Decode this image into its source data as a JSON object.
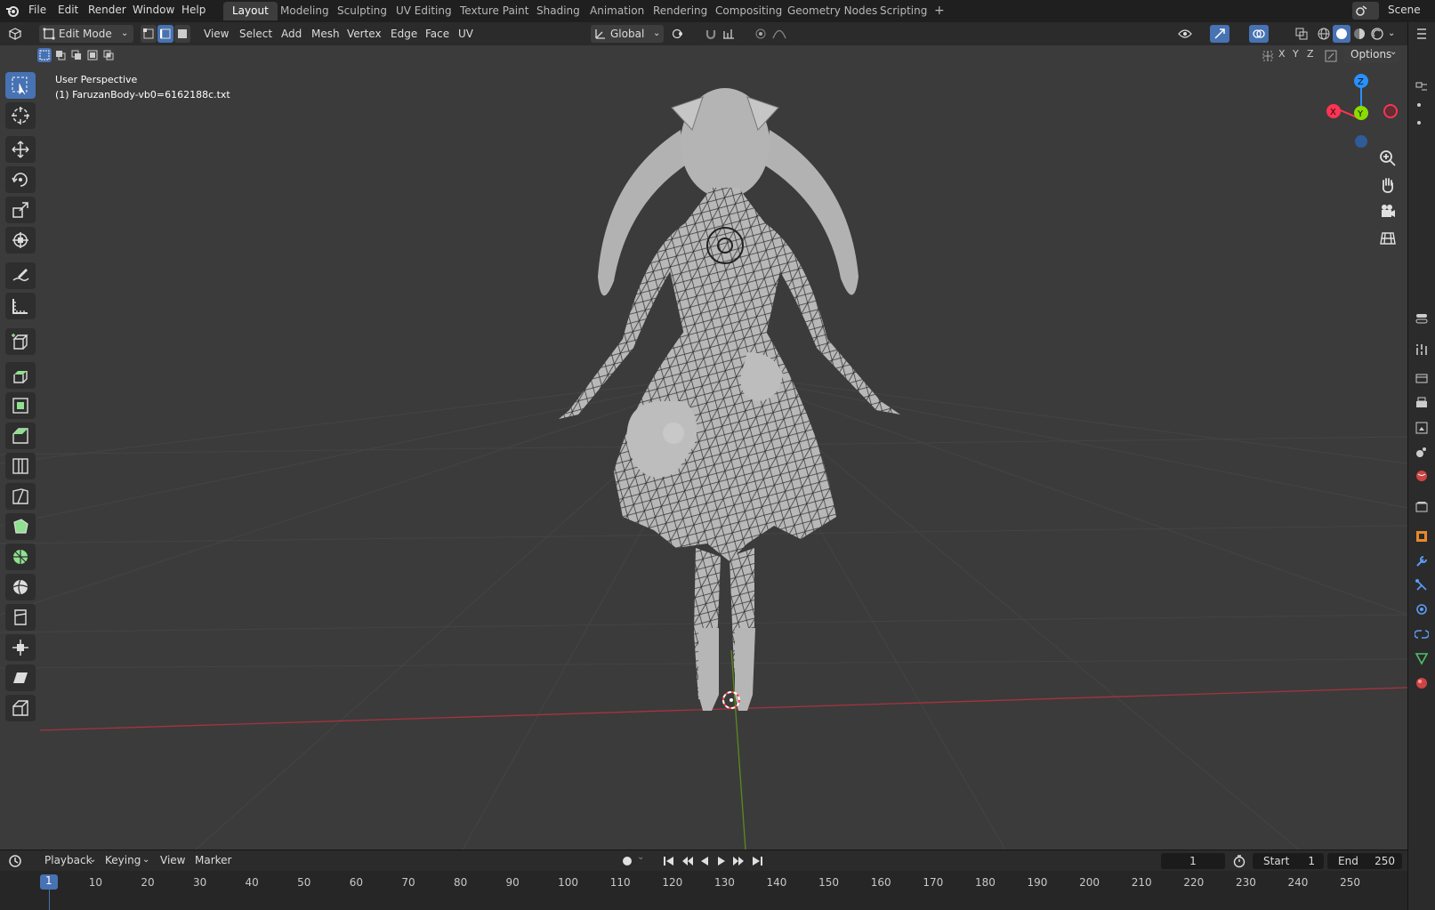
{
  "menubar": {
    "items": [
      "File",
      "Edit",
      "Render",
      "Window",
      "Help"
    ],
    "workspaces": [
      "Layout",
      "Modeling",
      "Sculpting",
      "UV Editing",
      "Texture Paint",
      "Shading",
      "Animation",
      "Rendering",
      "Compositing",
      "Geometry Nodes",
      "Scripting"
    ],
    "active_workspace": "Layout",
    "add_tab": "+",
    "scene": "Scene"
  },
  "header": {
    "mode": "Edit Mode",
    "menus": [
      "View",
      "Select",
      "Add",
      "Mesh",
      "Vertex",
      "Edge",
      "Face",
      "UV"
    ],
    "orientation": "Global",
    "options": "Options",
    "axes": [
      "X",
      "Y",
      "Z"
    ]
  },
  "viewport": {
    "view_name": "User Perspective",
    "object_name": "(1) FaruzanBody-vb0=6162188c.txt",
    "gizmo": {
      "z": "Z",
      "y": "Y",
      "x": "X"
    }
  },
  "toolbar": {
    "tools": [
      "select-box",
      "cursor",
      "move",
      "rotate",
      "scale",
      "transform",
      "annotate",
      "measure",
      "add-cube",
      "extrude",
      "inset",
      "bevel",
      "loop-cut",
      "knife",
      "poly-build",
      "spin",
      "smooth",
      "edge-slide",
      "shrink-fatten",
      "shear",
      "rip"
    ]
  },
  "timeline": {
    "menus": [
      "Playback",
      "Keying",
      "View",
      "Marker"
    ],
    "current_frame": "1",
    "start_label": "Start",
    "start_value": "1",
    "end_label": "End",
    "end_value": "250",
    "ticks": [
      "1",
      "10",
      "20",
      "30",
      "40",
      "50",
      "60",
      "70",
      "80",
      "90",
      "100",
      "110",
      "120",
      "130",
      "140",
      "150",
      "160",
      "170",
      "180",
      "190",
      "200",
      "210",
      "220",
      "230",
      "240",
      "250"
    ]
  },
  "colors": {
    "accent": "#4772b3",
    "axis_x": "#ff3352",
    "axis_y": "#8bdc00",
    "axis_z": "#2890ff"
  }
}
